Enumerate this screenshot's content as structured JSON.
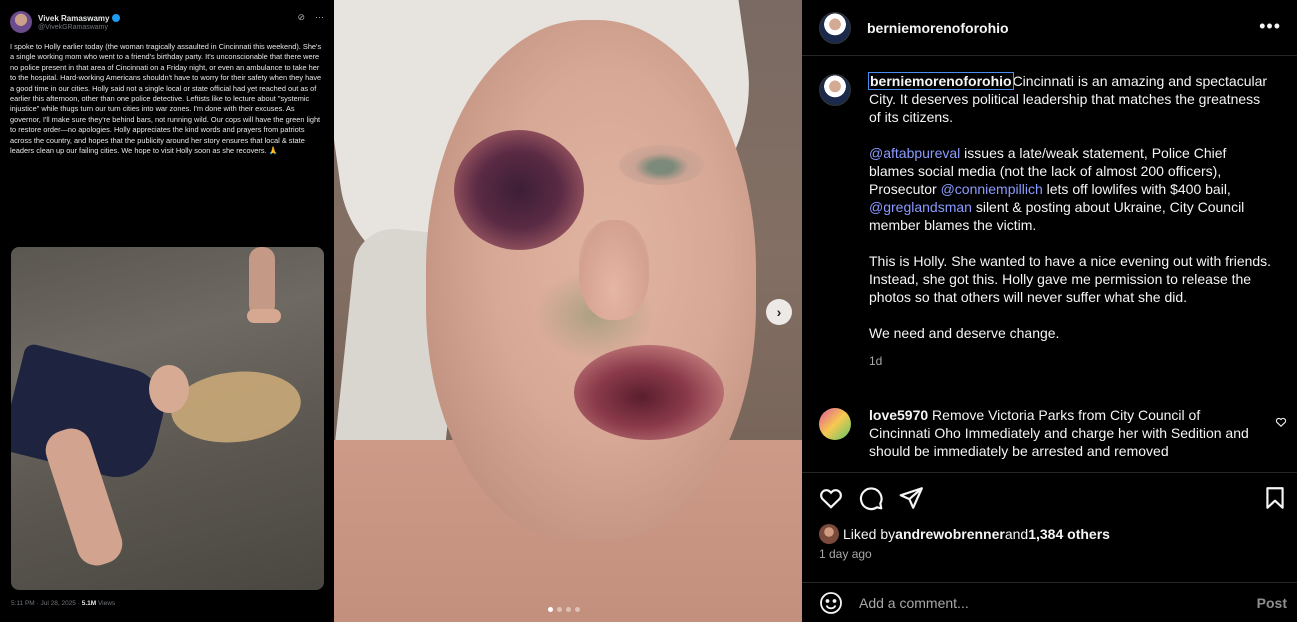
{
  "tweet": {
    "name": "Vivek Ramaswamy",
    "handle": "@VivekGRamaswamy",
    "text": "I spoke to Holly earlier today (the woman tragically assaulted in Cincinnati this weekend). She's a single working mom who went to a friend's birthday party. It's unconscionable that there were no police present in that area of Cincinnati on a Friday night, or even an ambulance to take her to the hospital. Hard-working Americans shouldn't have to worry for their safety when they have a good time in our cities. Holly said not a single local or state official had yet reached out as of earlier this afternoon, other than one police detective. Leftists like to lecture about \"systemic injustice\" while thugs turn our turn cities into war zones. I'm done with their excuses. As governor, I'll make sure they're behind bars, not running wild. Our cops will have the green light to restore order—no apologies. Holly appreciates the kind words and prayers from patriots across the country, and hopes that the publicity around her story ensures that local & state leaders clean up our failing cities. We hope to visit Holly soon as she recovers. 🙏",
    "timestamp": "5:11 PM · Jul 28, 2025 · ",
    "views": "5.1M",
    "views_label": " Views"
  },
  "carousel": {
    "next_label": "›",
    "dots_total": 4,
    "dots_active": 1
  },
  "post": {
    "username": "berniemorenoforohio",
    "more_label": "•••",
    "caption": {
      "username": "berniemorenoforohio",
      "p1": "Cincinnati is an amazing and spectacular City. It deserves political leadership that matches the greatness of its citizens.",
      "p2_m1": "@aftabpureval",
      "p2_t1": " issues a late/weak statement, Police Chief blames social media (not the lack of almost 200 officers), Prosecutor ",
      "p2_m2": "@conniempillich",
      "p2_t2": " lets off lowlifes with $400 bail, ",
      "p2_m3": "@greglandsman",
      "p2_t3": " silent & posting about Ukraine, City Council member blames the victim.",
      "p3": "This is Holly. She wanted to have a nice evening out with friends. Instead, she got this. Holly gave me permission to release the photos so that others will never suffer what she did.",
      "p4": "We need and deserve change.",
      "time": "1d"
    },
    "comment": {
      "username": "love5970",
      "text": " Remove Victoria Parks from City Council of Cincinnati Oho Immediately and charge her with Sedition and should be immediately be arrested and removed"
    },
    "likes": {
      "prefix": "Liked by ",
      "user": "andrewobrenner",
      "middle": " and ",
      "count": "1,384 others"
    },
    "time_ago": "1 day ago",
    "add_comment_placeholder": "Add a comment...",
    "post_label": "Post"
  },
  "colors": {
    "background": "#000000",
    "mention": "#8b9bff",
    "muted": "#a8a8a8",
    "highlight_outline": "#4a8ff5"
  },
  "icons": [
    "heart-icon",
    "comment-icon",
    "share-icon",
    "bookmark-icon",
    "emoji-icon",
    "verified-icon",
    "more-icon",
    "chevron-right-icon"
  ]
}
